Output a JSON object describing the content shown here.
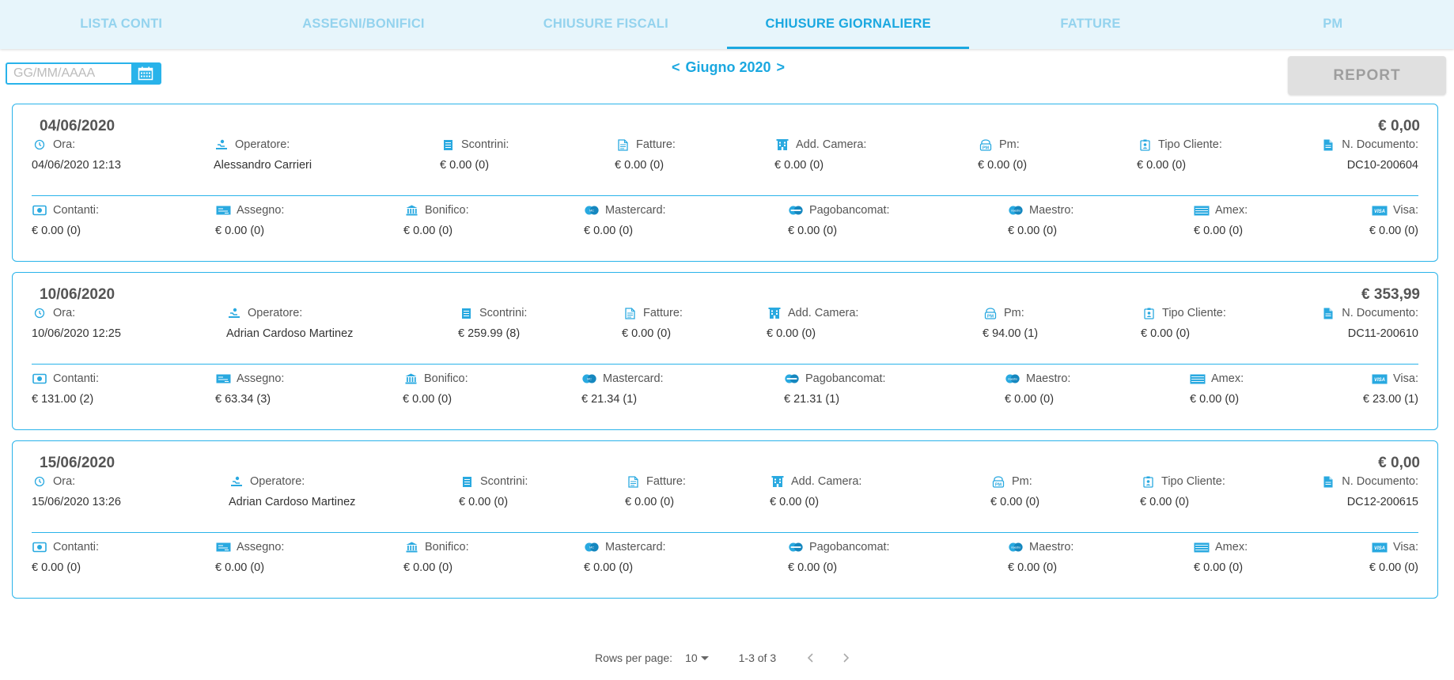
{
  "tabs": [
    {
      "label": "LISTA CONTI",
      "active": false
    },
    {
      "label": "ASSEGNI/BONIFICI",
      "active": false
    },
    {
      "label": "CHIUSURE FISCALI",
      "active": false
    },
    {
      "label": "CHIUSURE GIORNALIERE",
      "active": true
    },
    {
      "label": "FATTURE",
      "active": false
    },
    {
      "label": "PM",
      "active": false
    }
  ],
  "toolbar": {
    "date_placeholder": "GG/MM/AAAA",
    "month_prev": "<",
    "month_label": "Giugno 2020",
    "month_next": ">",
    "report_label": "REPORT"
  },
  "top_labels": [
    "Ora:",
    "Operatore:",
    "Scontrini:",
    "Fatture:",
    "Add. Camera:",
    "Pm:",
    "Tipo Cliente:",
    "N. Documento:"
  ],
  "bottom_labels": [
    "Contanti:",
    "Assegno:",
    "Bonifico:",
    "Mastercard:",
    "Pagobancomat:",
    "Maestro:",
    "Amex:",
    "Visa:"
  ],
  "icons_top": [
    "clock-icon",
    "operator-icon",
    "receipt-icon",
    "invoice-icon",
    "hotel-icon",
    "pm-icon",
    "client-badge-icon",
    "document-icon"
  ],
  "icons_bottom": [
    "cash-icon",
    "cheque-icon",
    "bank-icon",
    "mastercard-icon",
    "pagobancomat-icon",
    "maestro-icon",
    "amex-icon",
    "visa-icon"
  ],
  "colors": {
    "accent": "#1ba8e0",
    "tab_inactive": "#94d3ee",
    "tab_bar_bg": "#e7f5fb",
    "button_disabled": "#e0e0e0"
  },
  "closures": [
    {
      "date": "04/06/2020",
      "total": "€ 0,00",
      "top_values": [
        "04/06/2020 12:13",
        "Alessandro Carrieri",
        "€ 0.00 (0)",
        "€ 0.00 (0)",
        "€ 0.00 (0)",
        "€ 0.00 (0)",
        "€ 0.00 (0)",
        "DC10-200604"
      ],
      "bottom_values": [
        "€ 0.00 (0)",
        "€ 0.00 (0)",
        "€ 0.00 (0)",
        "€ 0.00 (0)",
        "€ 0.00 (0)",
        "€ 0.00 (0)",
        "€ 0.00 (0)",
        "€ 0.00 (0)"
      ]
    },
    {
      "date": "10/06/2020",
      "total": "€ 353,99",
      "top_values": [
        "10/06/2020 12:25",
        "Adrian Cardoso Martinez",
        "€ 259.99 (8)",
        "€ 0.00 (0)",
        "€ 0.00 (0)",
        "€ 94.00 (1)",
        "€ 0.00 (0)",
        "DC11-200610"
      ],
      "bottom_values": [
        "€ 131.00 (2)",
        "€ 63.34 (3)",
        "€ 0.00 (0)",
        "€ 21.34 (1)",
        "€ 21.31 (1)",
        "€ 0.00 (0)",
        "€ 0.00 (0)",
        "€ 23.00 (1)"
      ]
    },
    {
      "date": "15/06/2020",
      "total": "€ 0,00",
      "top_values": [
        "15/06/2020 13:26",
        "Adrian Cardoso Martinez",
        "€ 0.00 (0)",
        "€ 0.00 (0)",
        "€ 0.00 (0)",
        "€ 0.00 (0)",
        "€ 0.00 (0)",
        "DC12-200615"
      ],
      "bottom_values": [
        "€ 0.00 (0)",
        "€ 0.00 (0)",
        "€ 0.00 (0)",
        "€ 0.00 (0)",
        "€ 0.00 (0)",
        "€ 0.00 (0)",
        "€ 0.00 (0)",
        "€ 0.00 (0)"
      ]
    }
  ],
  "pagination": {
    "rows_label": "Rows per page:",
    "rows_value": "10",
    "range": "1-3 of 3"
  }
}
